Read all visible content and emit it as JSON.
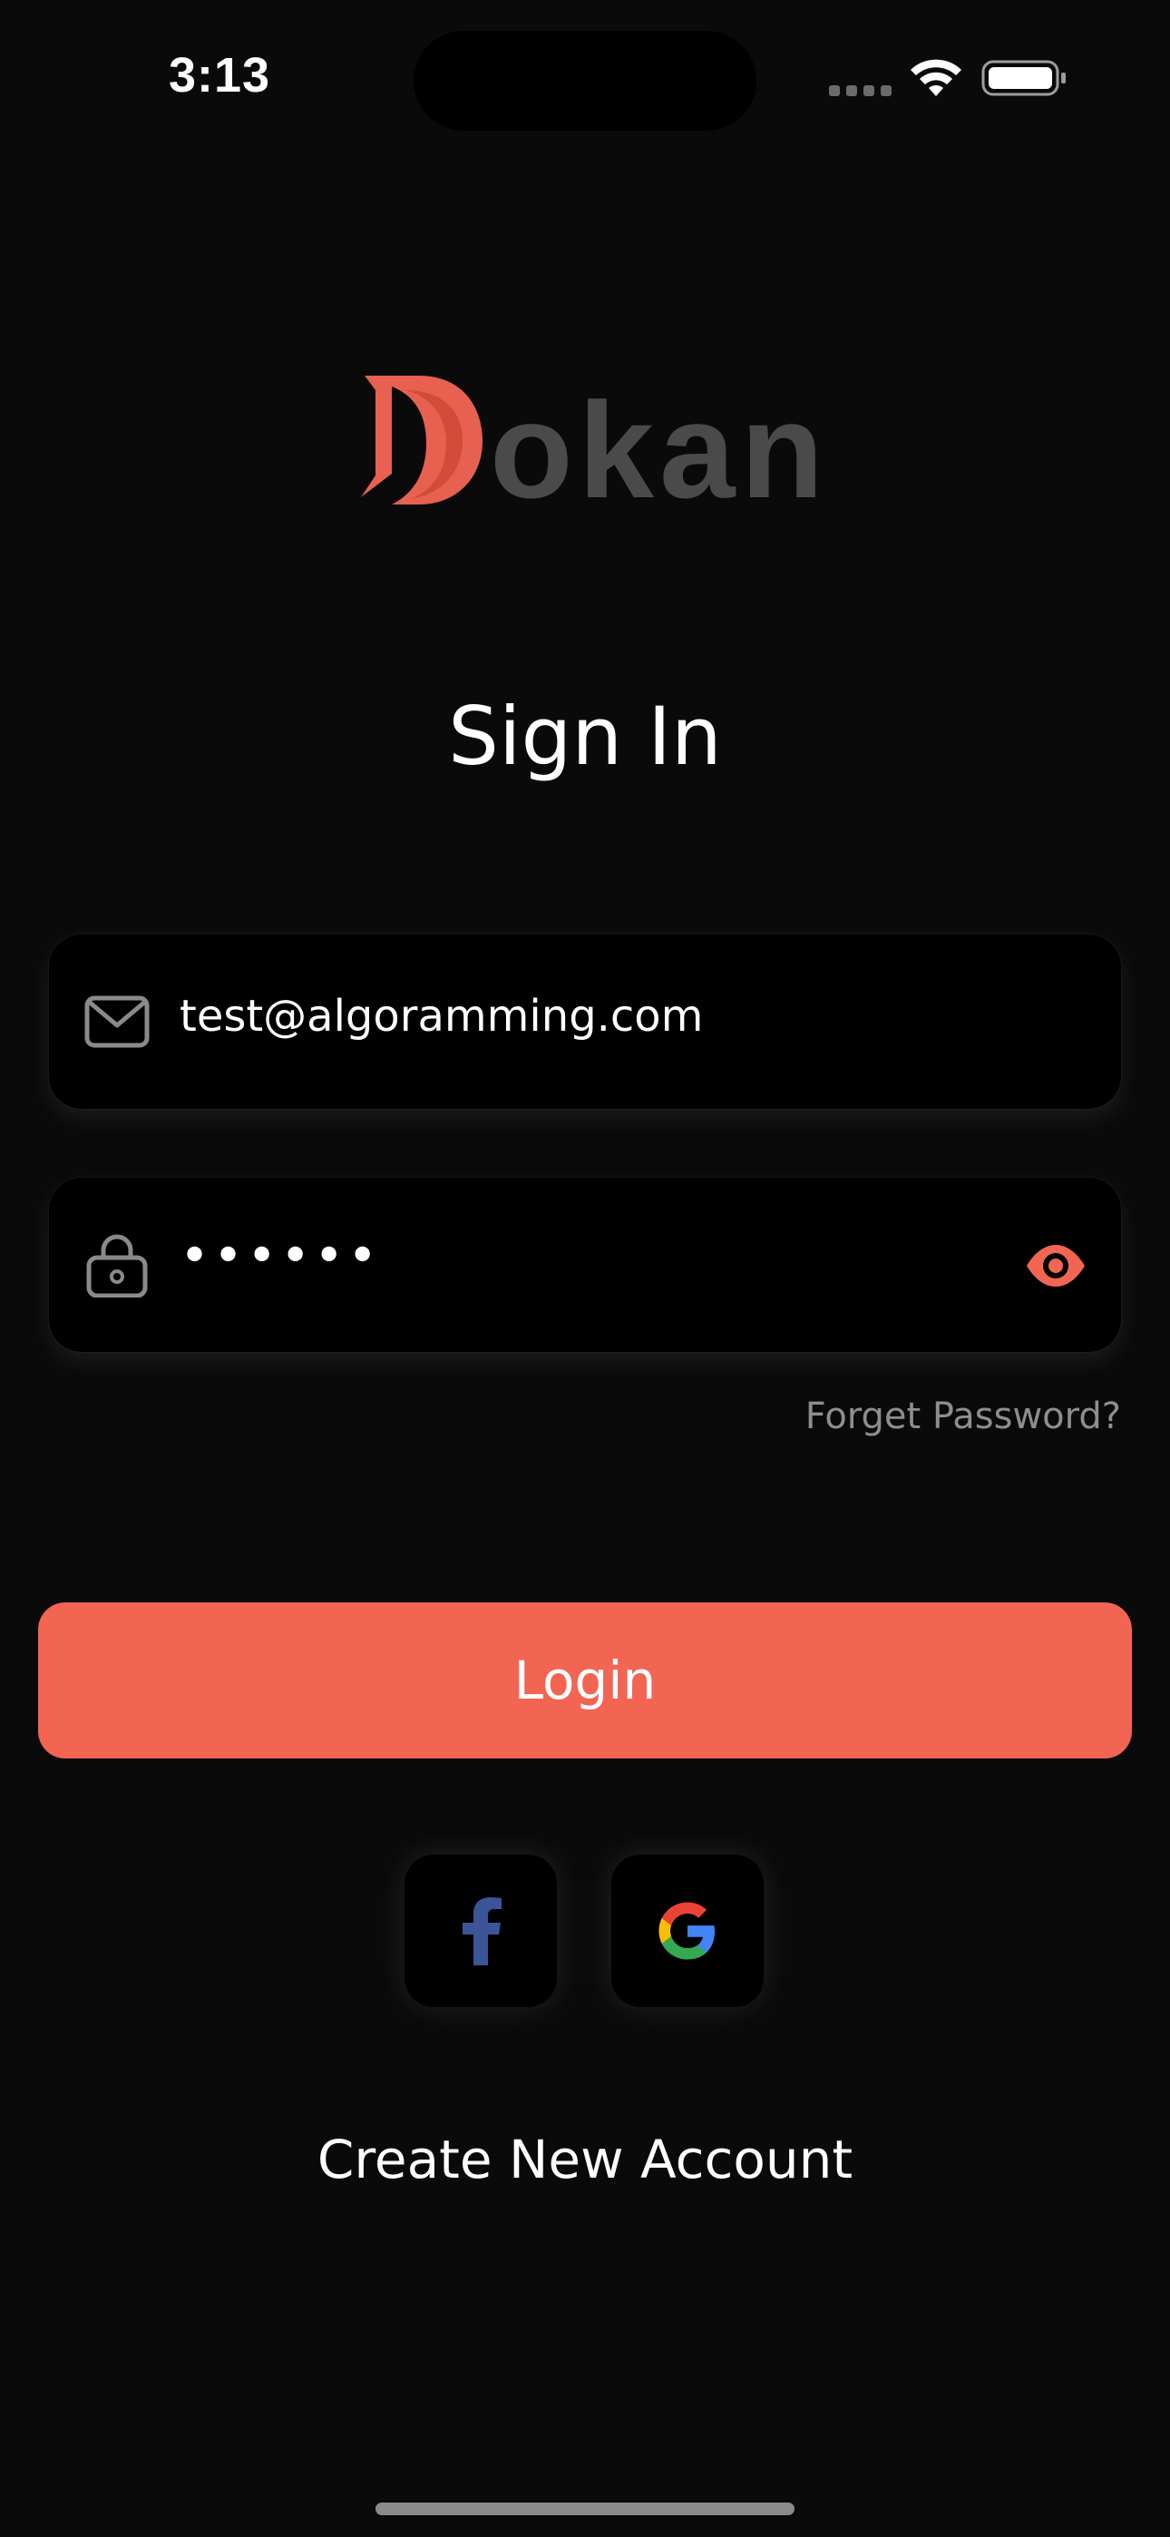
{
  "status_bar": {
    "time": "3:13"
  },
  "logo": {
    "text": "Dokan",
    "accent_color": "#e8604f",
    "text_color": "#4a4a4a"
  },
  "title": "Sign In",
  "email_field": {
    "value": "test@algoramming.com",
    "icon": "mail-icon"
  },
  "password_field": {
    "value": "••••••",
    "icon": "lock-icon",
    "toggle_icon": "eye-icon"
  },
  "forgot_password": "Forget Password?",
  "login_button": "Login",
  "social": {
    "facebook_icon": "facebook-icon",
    "google_icon": "google-icon"
  },
  "create_account": "Create New Account",
  "colors": {
    "background": "#0a0a0a",
    "accent": "#f26552",
    "field": "#000000"
  }
}
